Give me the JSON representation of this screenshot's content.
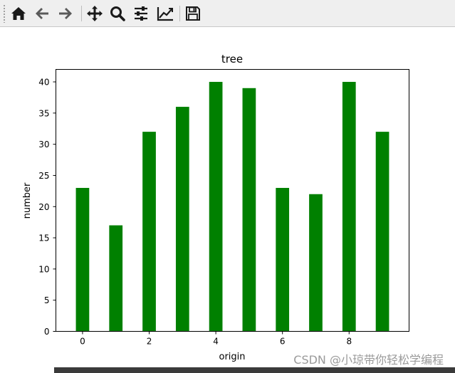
{
  "toolbar": {
    "tools": [
      {
        "name": "home-icon"
      },
      {
        "name": "back-arrow-icon"
      },
      {
        "name": "forward-arrow-icon"
      },
      {
        "name": "pan-icon"
      },
      {
        "name": "zoom-icon"
      },
      {
        "name": "configure-subplots-icon"
      },
      {
        "name": "edit-axis-icon"
      },
      {
        "name": "save-icon"
      }
    ]
  },
  "colors": {
    "bar": "#008000",
    "toolbar_bg": "#efefef",
    "icon": "#1a1a1a"
  },
  "chart_data": {
    "type": "bar",
    "title": "tree",
    "xlabel": "origin",
    "ylabel": "number",
    "x": [
      0,
      1,
      2,
      3,
      4,
      5,
      6,
      7,
      8,
      9
    ],
    "values": [
      23,
      17,
      32,
      36,
      40,
      39,
      23,
      22,
      40,
      32
    ],
    "xlim": [
      -0.8,
      9.8
    ],
    "ylim": [
      0,
      42
    ],
    "xticks": [
      "0",
      "2",
      "4",
      "6",
      "8"
    ],
    "yticks": [
      "0",
      "5",
      "10",
      "15",
      "20",
      "25",
      "30",
      "35",
      "40"
    ],
    "grid": false,
    "color": "#008000"
  },
  "watermark": "CSDN @小琼带你轻松学编程"
}
